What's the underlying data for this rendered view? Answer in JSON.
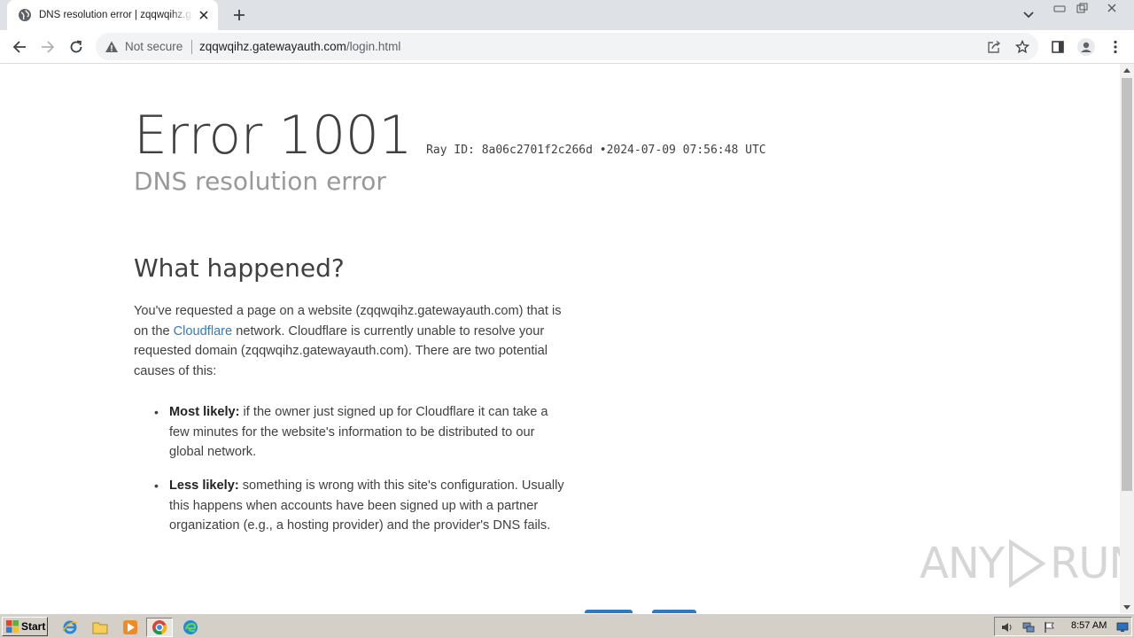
{
  "browser": {
    "tab": {
      "title": "DNS resolution error | zqqwqihz.gatewayauth.com"
    },
    "omnibox": {
      "security_label": "Not secure",
      "url_host": "zqqwqihz.gatewayauth.com",
      "url_path": "/login.html"
    }
  },
  "page": {
    "error_code": "Error 1001",
    "ray_label": "Ray ID: 8a06c2701f2c266d",
    "bullet_sep": "•",
    "timestamp": "2024-07-09 07:56:48 UTC",
    "error_title": "DNS resolution error",
    "section_title": "What happened?",
    "para_part1": "You've requested a page on a website (zqqwqihz.gatewayauth.com) that is on the ",
    "cloudflare_link": "Cloudflare",
    "para_part2": " network. Cloudflare is currently unable to resolve your requested domain (zqqwqihz.gatewayauth.com). There are two potential causes of this:",
    "causes": [
      {
        "label": "Most likely:",
        "text": " if the owner just signed up for Cloudflare it can take a few minutes for the website's information to be distributed to our global network."
      },
      {
        "label": "Less likely:",
        "text": " something is wrong with this site's configuration. Usually this happens when accounts have been signed up with a partner organization (e.g., a hosting provider) and the provider's DNS fails."
      }
    ],
    "watermark_left": "ANY",
    "watermark_right": "RUN"
  },
  "taskbar": {
    "start_label": "Start",
    "clock": "8:57 AM"
  },
  "colors": {
    "link": "#2f7bbf",
    "heading": "#404040",
    "subheading": "#999999"
  }
}
